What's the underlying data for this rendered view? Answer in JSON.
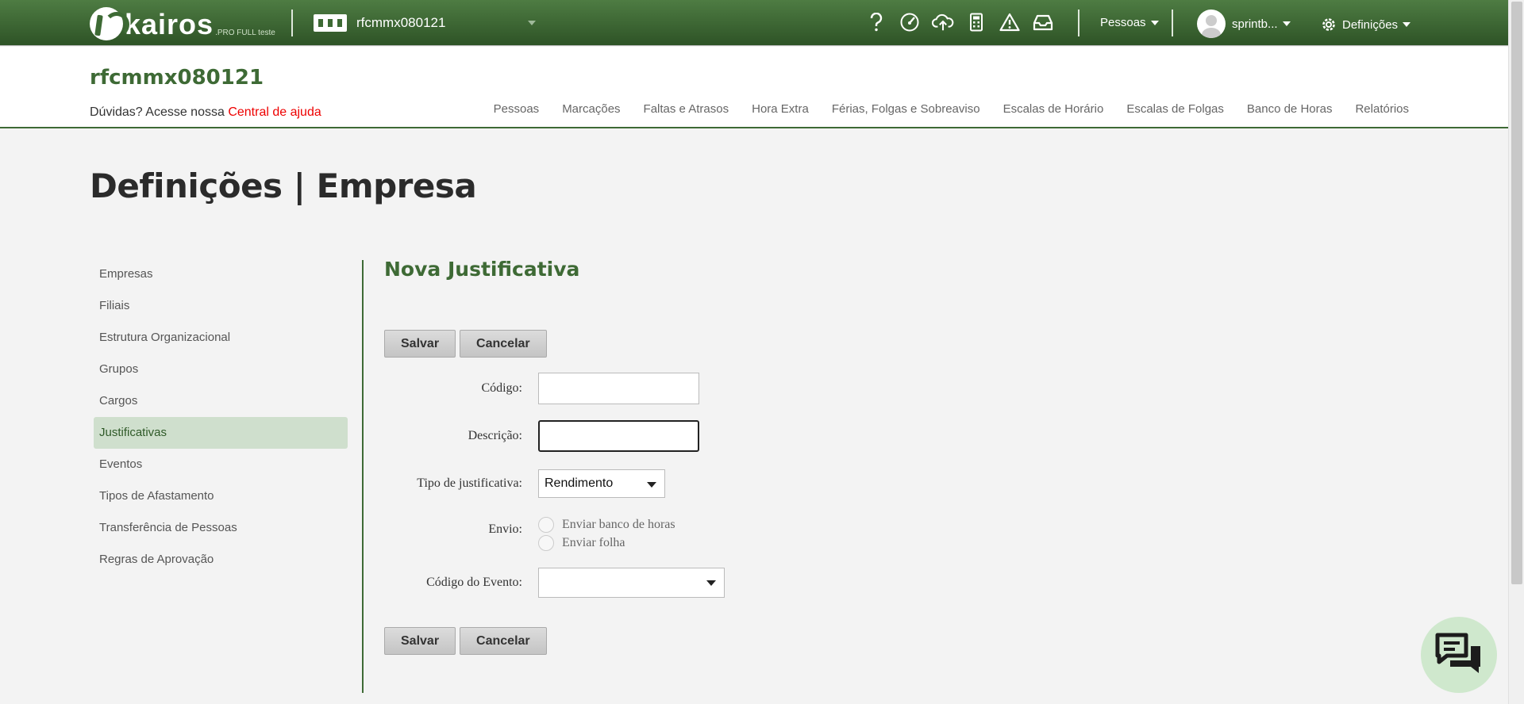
{
  "topbar": {
    "logo_text": "kairos",
    "logo_sub": ".PRO FULL teste",
    "company": "rfcmmx080121",
    "icons": [
      "help-icon",
      "speedometer-icon",
      "cloud-upload-icon",
      "calculator-icon",
      "warning-icon",
      "inbox-icon"
    ],
    "pessoas_label": "Pessoas",
    "user_label": "sprintb...",
    "settings_label": "Definições"
  },
  "header": {
    "site_title": "rfcmmx080121",
    "help_prefix": "Dúvidas? Acesse nossa",
    "help_link": "Central de ajuda",
    "nav": [
      "Pessoas",
      "Marcações",
      "Faltas e Atrasos",
      "Hora Extra",
      "Férias, Folgas e Sobreaviso",
      "Escalas de Horário",
      "Escalas de Folgas",
      "Banco de Horas",
      "Relatórios"
    ]
  },
  "page": {
    "title": "Definições | Empresa"
  },
  "sidebar": {
    "items": [
      "Empresas",
      "Filiais",
      "Estrutura Organizacional",
      "Grupos",
      "Cargos",
      "Justificativas",
      "Eventos",
      "Tipos de Afastamento",
      "Transferência de Pessoas",
      "Regras de Aprovação"
    ],
    "active": "Justificativas"
  },
  "form": {
    "title": "Nova Justificativa",
    "save_label": "Salvar",
    "cancel_label": "Cancelar",
    "codigo_label": "Código:",
    "codigo_value": "",
    "descricao_label": "Descrição:",
    "descricao_value": "",
    "tipo_label": "Tipo de justificativa:",
    "tipo_value": "Rendimento",
    "envio_label": "Envio:",
    "envio_options": [
      "Enviar banco de horas",
      "Enviar folha"
    ],
    "evento_label": "Código do Evento:",
    "evento_value": ""
  },
  "colors": {
    "brand_green": "#3e6a35",
    "active_bg": "#cfdfcd",
    "link_red": "#ee0000"
  }
}
